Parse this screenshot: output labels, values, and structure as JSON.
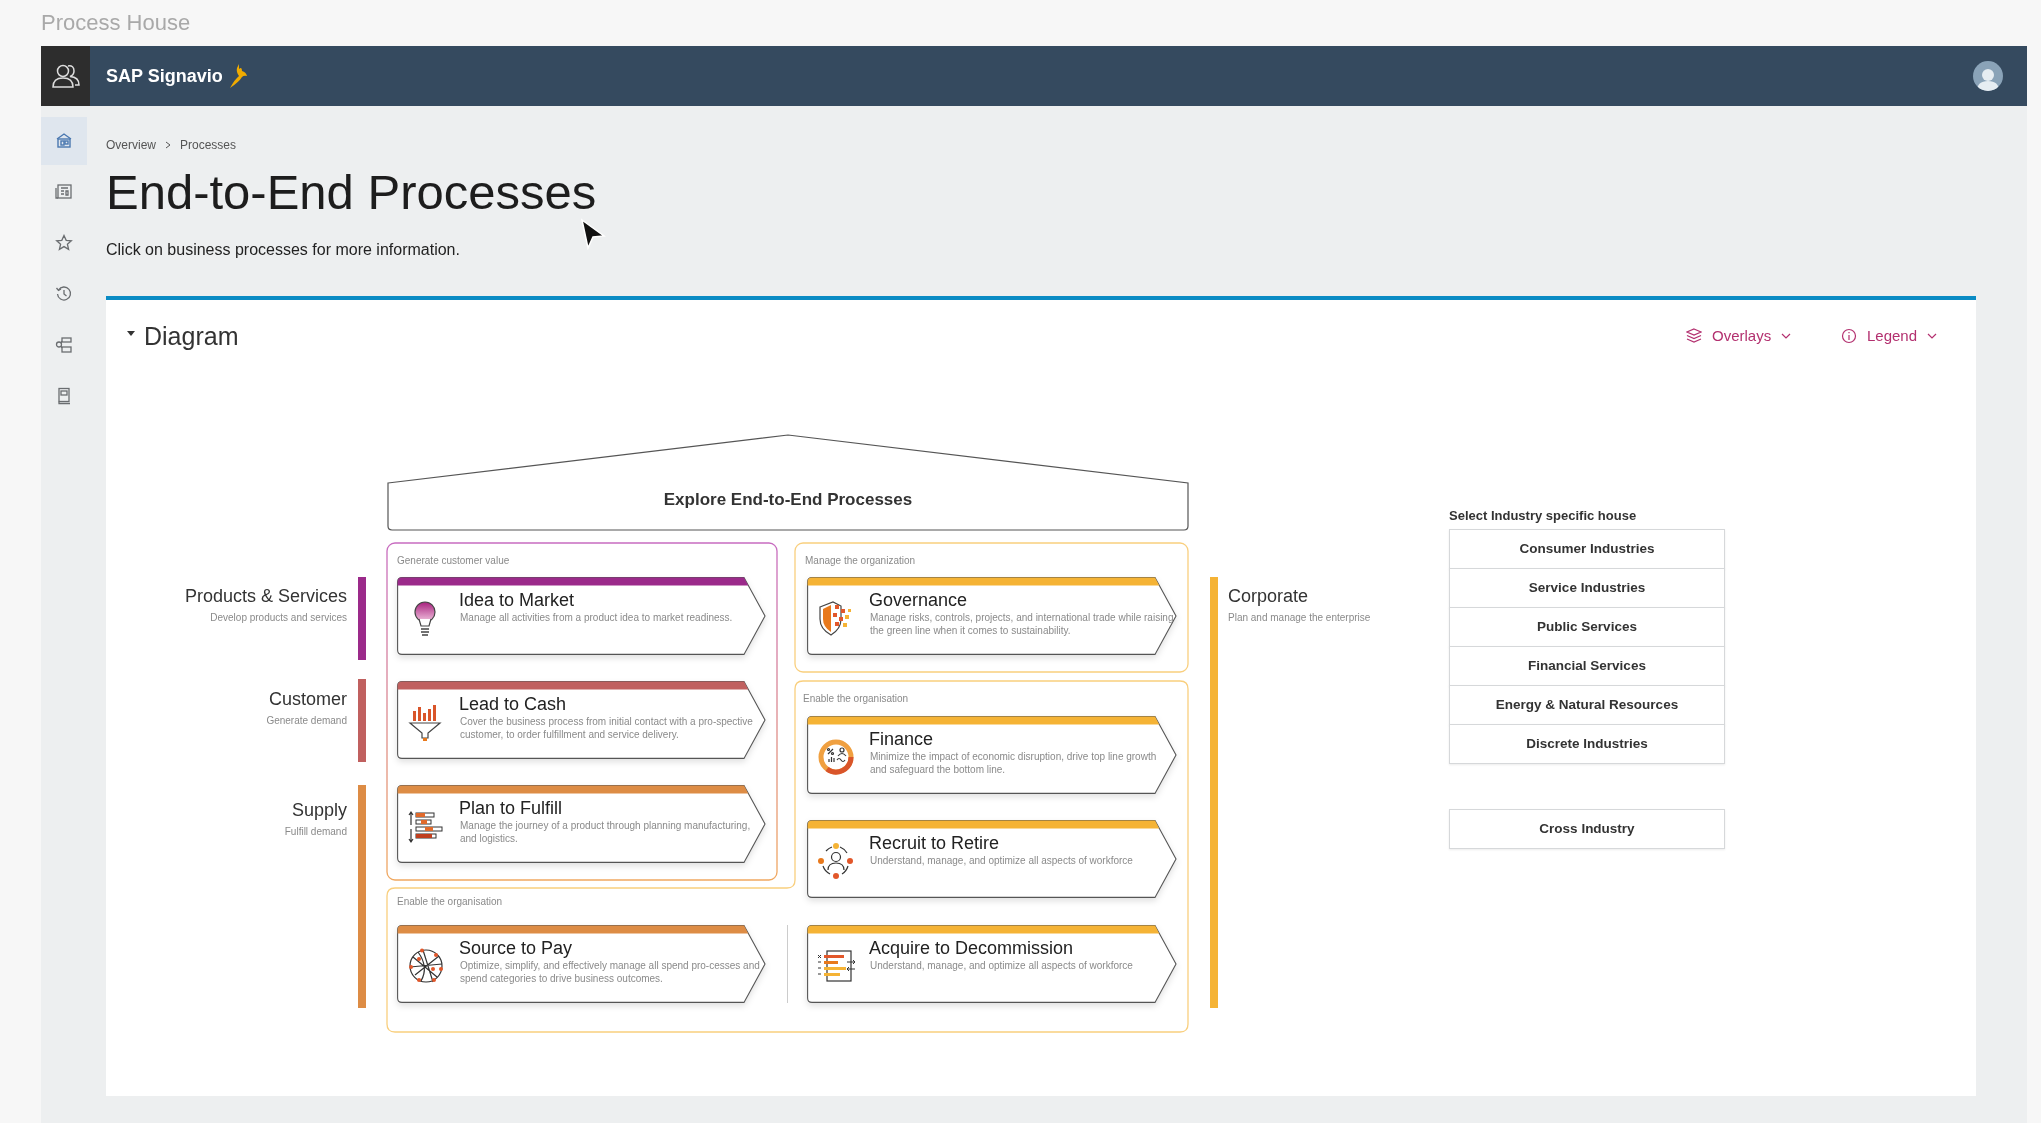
{
  "window": {
    "title": "Process House"
  },
  "header": {
    "brand": "SAP Signavio"
  },
  "sidebar": {
    "items": [
      {
        "kind": "home",
        "selected": true
      },
      {
        "kind": "news",
        "selected": false
      },
      {
        "kind": "star",
        "selected": false
      },
      {
        "kind": "history",
        "selected": false
      },
      {
        "kind": "hierarchy",
        "selected": false
      },
      {
        "kind": "book",
        "selected": false
      }
    ]
  },
  "breadcrumb": [
    "Overview",
    "Processes"
  ],
  "title": "End-to-End Processes",
  "subtitle": "Click on business processes for more information.",
  "panel": {
    "title": "Diagram",
    "expanded": true,
    "actions": [
      {
        "label": "Overlays",
        "kind": "layers"
      },
      {
        "label": "Legend",
        "kind": "info"
      }
    ]
  },
  "house": {
    "roof": "Explore End-to-End Processes",
    "lanes": [
      {
        "name": "Products & Services",
        "description": "Develop products and services",
        "color": "#9b2a8a"
      },
      {
        "name": "Customer",
        "description": "Generate demand",
        "color": "#c0605f"
      },
      {
        "name": "Supply",
        "description": "Fulfill demand",
        "color": "#dd8c45"
      },
      {
        "name": "Corporate",
        "description": "Plan and manage the enterprise",
        "color": "#f5b335"
      }
    ],
    "groups": [
      {
        "label": "Generate customer value"
      },
      {
        "label": "Manage the organization"
      },
      {
        "label": "Enable the organisation"
      },
      {
        "label": "Enable the organisation"
      }
    ],
    "processes": [
      {
        "title": "Idea to Market",
        "description": "Manage all activities from a product idea to market readiness.",
        "color": "#9b2a8a",
        "kind": "bulb"
      },
      {
        "title": "Lead to Cash",
        "description": "Cover the business process from initial contact with a pro-spective customer, to order fulfillment and service delivery.",
        "color": "#c0605f",
        "kind": "funnel"
      },
      {
        "title": "Plan to Fulfill",
        "description": "Manage the journey of a product through planning manufacturing, and logistics.",
        "color": "#dd8c45",
        "kind": "bars"
      },
      {
        "title": "Source to Pay",
        "description": "Optimize, simplify, and effectively manage all spend pro-cesses and spend categories to drive business outcomes.",
        "color": "#dd8c45",
        "kind": "globe"
      },
      {
        "title": "Governance",
        "description": "Manage risks, controls, projects, and international trade while raising the green line when it comes to sustainability.",
        "color": "#f5b335",
        "kind": "shield"
      },
      {
        "title": "Finance",
        "description": "Minimize the impact of economic disruption, drive top line growth and safeguard the bottom line.",
        "color": "#f5b335",
        "kind": "donut"
      },
      {
        "title": "Recruit to Retire",
        "description": "Understand, manage, and optimize all aspects of workforce",
        "color": "#f5b335",
        "kind": "people"
      },
      {
        "title": "Acquire to Decommission",
        "description": "Understand, manage, and optimize all aspects of workforce",
        "color": "#f5b335",
        "kind": "list"
      }
    ]
  },
  "industries": {
    "title": "Select Industry specific house",
    "items": [
      "Consumer Industries",
      "Service Industries",
      "Public Services",
      "Financial Services",
      "Energy & Natural Resources",
      "Discrete Industries"
    ],
    "cross": "Cross Industry"
  }
}
